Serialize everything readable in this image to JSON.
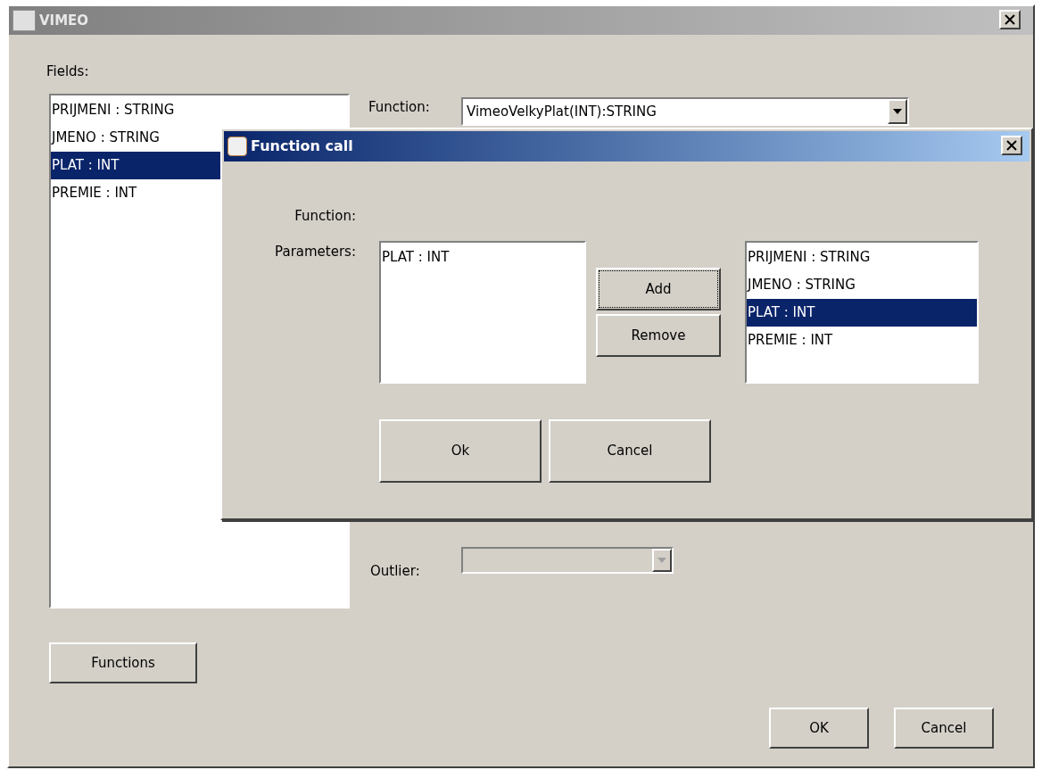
{
  "window": {
    "title": "VIMEO"
  },
  "fields_label": "Fields:",
  "fields": [
    {
      "label": "PRIJMENI : STRING",
      "selected": false
    },
    {
      "label": "JMENO : STRING",
      "selected": false
    },
    {
      "label": "PLAT : INT",
      "selected": true
    },
    {
      "label": "PREMIE : INT",
      "selected": false
    }
  ],
  "function_label": "Function:",
  "function_combo": {
    "value": "VimeoVelkyPlat(INT):STRING",
    "disabled": false
  },
  "outlier_label": "Outlier:",
  "outlier_combo": {
    "disabled": true
  },
  "functions_button": "Functions",
  "buttons": [
    "OK",
    "Cancel"
  ],
  "dialog": {
    "title": "Function call",
    "function_label": "Function:",
    "parameters_label": "Parameters:",
    "parameters": [
      {
        "label": "PLAT : INT",
        "selected": false
      }
    ],
    "side_buttons": [
      {
        "label": "Add",
        "focused": true
      },
      {
        "label": "Remove",
        "focused": false
      }
    ],
    "available": [
      {
        "label": "PRIJMENI : STRING",
        "selected": false
      },
      {
        "label": "JMENO : STRING",
        "selected": false
      },
      {
        "label": "PLAT : INT",
        "selected": true
      },
      {
        "label": "PREMIE : INT",
        "selected": false
      }
    ],
    "buttons": [
      "Ok",
      "Cancel"
    ]
  }
}
